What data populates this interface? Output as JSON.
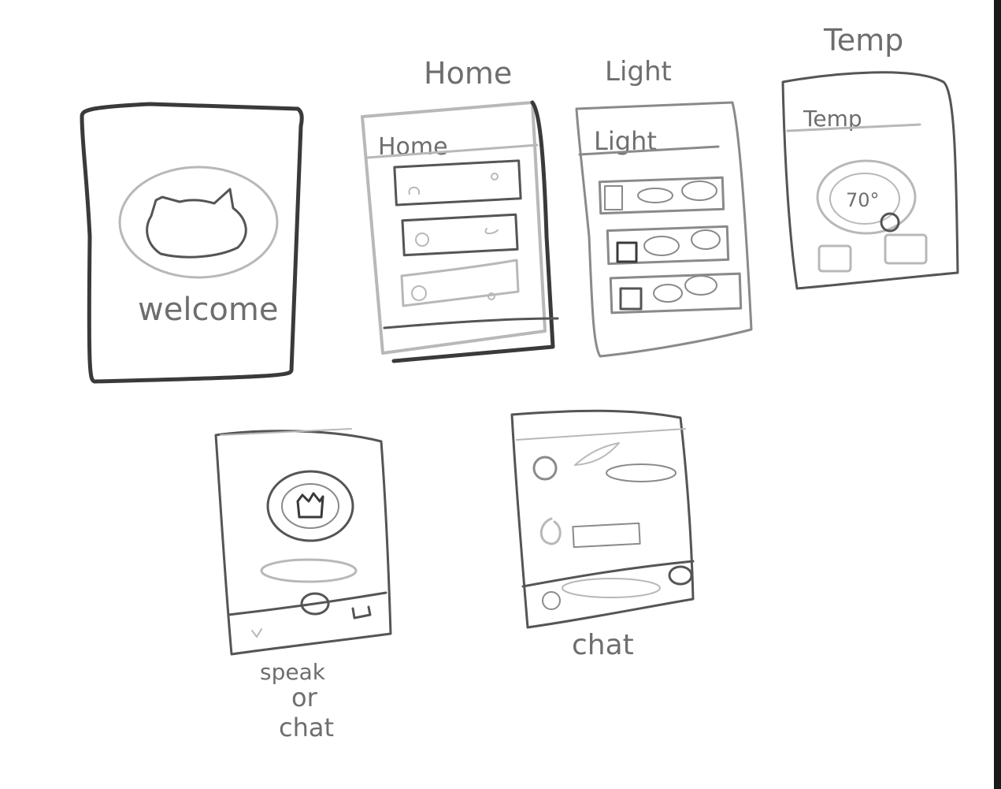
{
  "screens": {
    "welcome": {
      "title": "",
      "label": "welcome"
    },
    "home": {
      "title": "Home",
      "header": "Home"
    },
    "light": {
      "title": "Light",
      "header": "Light"
    },
    "temp": {
      "title": "Temp",
      "header": "Temp",
      "readout": "70°"
    },
    "speak": {
      "caption_line1": "speak",
      "caption_line2": "or",
      "caption_line3": "chat"
    },
    "chat": {
      "caption": "chat"
    }
  },
  "colors": {
    "ink_dark": "#3a3a3a",
    "ink_mid": "#8a8a8a",
    "ink_light": "#b8b8b8",
    "background": "#ffffff"
  }
}
